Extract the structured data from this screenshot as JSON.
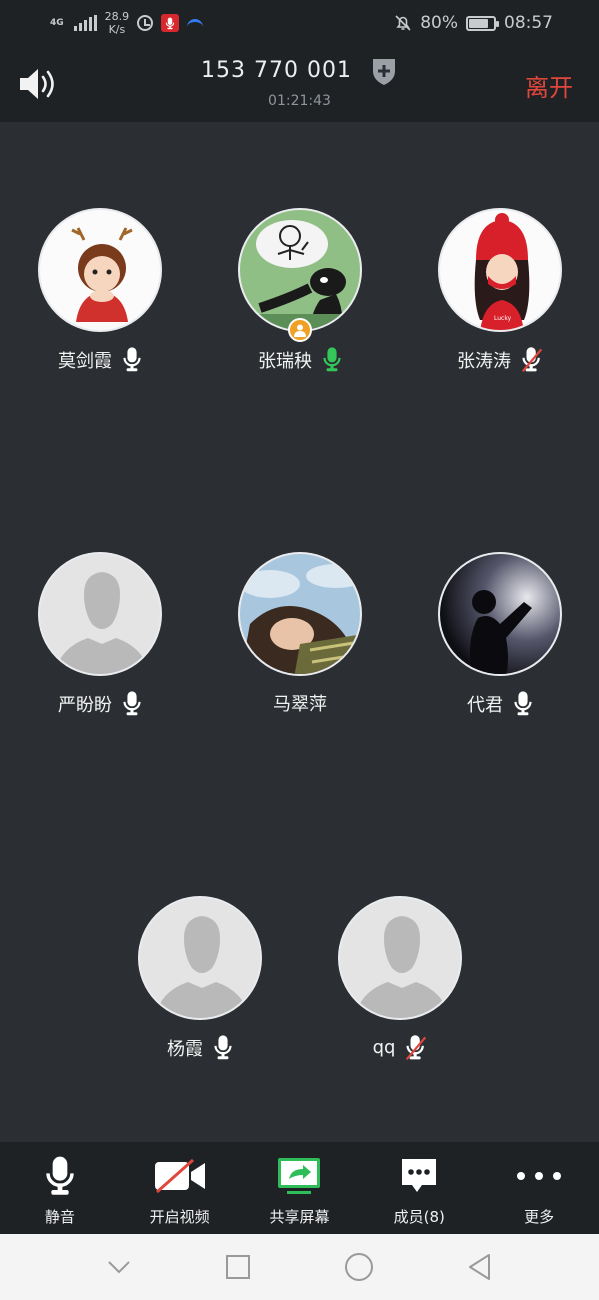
{
  "status_bar": {
    "network_type": "4G",
    "net_speed_value": "28.9",
    "net_speed_unit": "K/s",
    "battery_percent": "80%",
    "time": "08:57"
  },
  "header": {
    "meeting_id": "153 770 001",
    "elapsed": "01:21:43",
    "leave_label": "离开"
  },
  "participants": [
    {
      "name": "莫剑霞",
      "mic": "on",
      "avatar": "cartoon-girl-antlers"
    },
    {
      "name": "张瑞秧",
      "mic": "speaking",
      "avatar": "penguin-meme",
      "host": true
    },
    {
      "name": "张涛涛",
      "mic": "muted",
      "avatar": "cartoon-girl-red-hat"
    },
    {
      "name": "严盼盼",
      "mic": "on",
      "avatar": "default"
    },
    {
      "name": "马翠萍",
      "mic": "none",
      "avatar": "girl-photo"
    },
    {
      "name": "代君",
      "mic": "on",
      "avatar": "silhouette-photo"
    },
    {
      "name": "杨霞",
      "mic": "on",
      "avatar": "default"
    },
    {
      "name": "qq",
      "mic": "muted",
      "avatar": "default"
    }
  ],
  "toolbar": {
    "mute_label": "静音",
    "video_label": "开启视频",
    "share_label": "共享屏幕",
    "members_label": "成员(8)",
    "more_label": "更多"
  },
  "colors": {
    "background": "#2b2f33",
    "bar": "#1f2225",
    "leave": "#e0473c",
    "speaking": "#34c759",
    "muted": "#e0473c",
    "host": "#f0a024"
  }
}
